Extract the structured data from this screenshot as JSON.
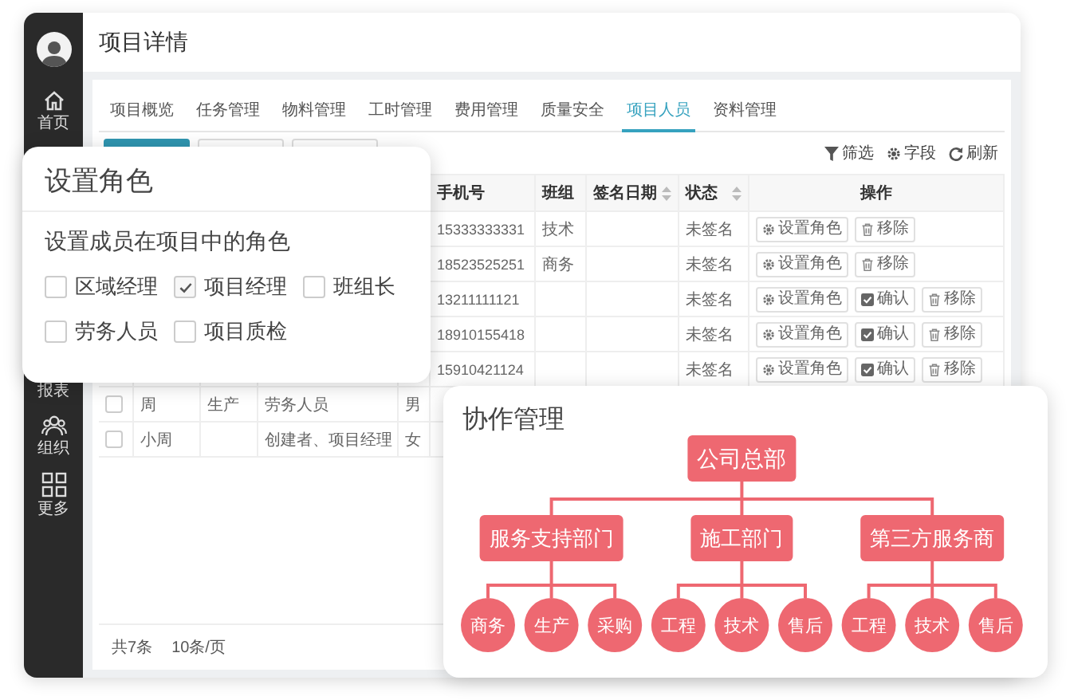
{
  "sidebar": {
    "items": [
      {
        "label": "首页",
        "kind": "home"
      },
      {
        "label": "报表",
        "kind": "report"
      },
      {
        "label": "组织",
        "kind": "org"
      },
      {
        "label": "更多",
        "kind": "more"
      }
    ]
  },
  "header": {
    "title": "项目详情"
  },
  "tabs": [
    {
      "label": "项目概览",
      "selected": false
    },
    {
      "label": "任务管理",
      "selected": false
    },
    {
      "label": "物料管理",
      "selected": false
    },
    {
      "label": "工时管理",
      "selected": false
    },
    {
      "label": "费用管理",
      "selected": false
    },
    {
      "label": "质量安全",
      "selected": false
    },
    {
      "label": "项目人员",
      "selected": true
    },
    {
      "label": "资料管理",
      "selected": false
    }
  ],
  "toolbar": [
    {
      "label": "筛选",
      "kind": "filter"
    },
    {
      "label": "字段",
      "kind": "field"
    },
    {
      "label": "刷新",
      "kind": "refresh"
    }
  ],
  "table": {
    "columns": [
      {
        "label": "手机号",
        "sortable": false
      },
      {
        "label": "班组",
        "sortable": false
      },
      {
        "label": "签名日期",
        "sortable": true
      },
      {
        "label": "状态",
        "sortable": true
      },
      {
        "label": "操作",
        "sortable": false
      }
    ],
    "rows": [
      {
        "phone": "15333333331",
        "team": "技术",
        "status": "未签名",
        "actions": [
          {
            "label": "设置角色",
            "kind": "role"
          },
          {
            "label": "移除",
            "kind": "remove"
          }
        ]
      },
      {
        "phone": "18523525251",
        "team": "商务",
        "status": "未签名",
        "actions": [
          {
            "label": "设置角色",
            "kind": "role"
          },
          {
            "label": "移除",
            "kind": "remove"
          }
        ]
      },
      {
        "phone": "13211111121",
        "status": "未签名",
        "actions": [
          {
            "label": "设置角色",
            "kind": "role"
          },
          {
            "label": "确认",
            "kind": "confirm"
          },
          {
            "label": "移除",
            "kind": "remove"
          }
        ]
      },
      {
        "phone": "18910155418",
        "status": "未签名",
        "actions": [
          {
            "label": "设置角色",
            "kind": "role"
          },
          {
            "label": "确认",
            "kind": "confirm"
          },
          {
            "label": "移除",
            "kind": "remove"
          }
        ]
      },
      {
        "phone": "15910421124",
        "status": "未签名",
        "actions": [
          {
            "label": "设置角色",
            "kind": "role"
          },
          {
            "label": "确认",
            "kind": "confirm"
          },
          {
            "label": "移除",
            "kind": "remove"
          }
        ]
      },
      {
        "checked": false,
        "column_2": "周",
        "column_3": "生产",
        "column_4": "劳务人员",
        "column_5": "男"
      },
      {
        "checked": false,
        "column_2": "小周",
        "column_4": "创建者、项目经理",
        "column_5": "女"
      }
    ]
  },
  "footer": {
    "total": "共7条",
    "page_size": "10条/页"
  },
  "role_dialog": {
    "title": "设置角色",
    "subtitle": "设置成员在项目中的角色",
    "options": [
      {
        "label": "区域经理",
        "checked": false
      },
      {
        "label": "项目经理",
        "checked": true
      },
      {
        "label": "班组长",
        "checked": false
      },
      {
        "label": "劳务人员",
        "checked": false
      },
      {
        "label": "项目质检",
        "checked": false
      }
    ]
  },
  "org_chart": {
    "title": "协作管理",
    "root": {
      "label": "公司总部",
      "children": [
        {
          "label": "服务支持部门",
          "children": [
            {
              "label": "商务"
            },
            {
              "label": "生产"
            },
            {
              "label": "采购"
            }
          ]
        },
        {
          "label": "施工部门",
          "children": [
            {
              "label": "工程"
            },
            {
              "label": "技术"
            },
            {
              "label": "售后"
            }
          ]
        },
        {
          "label": "第三方服务商",
          "children": [
            {
              "label": "工程"
            },
            {
              "label": "技术"
            },
            {
              "label": "售后"
            }
          ]
        }
      ]
    }
  }
}
